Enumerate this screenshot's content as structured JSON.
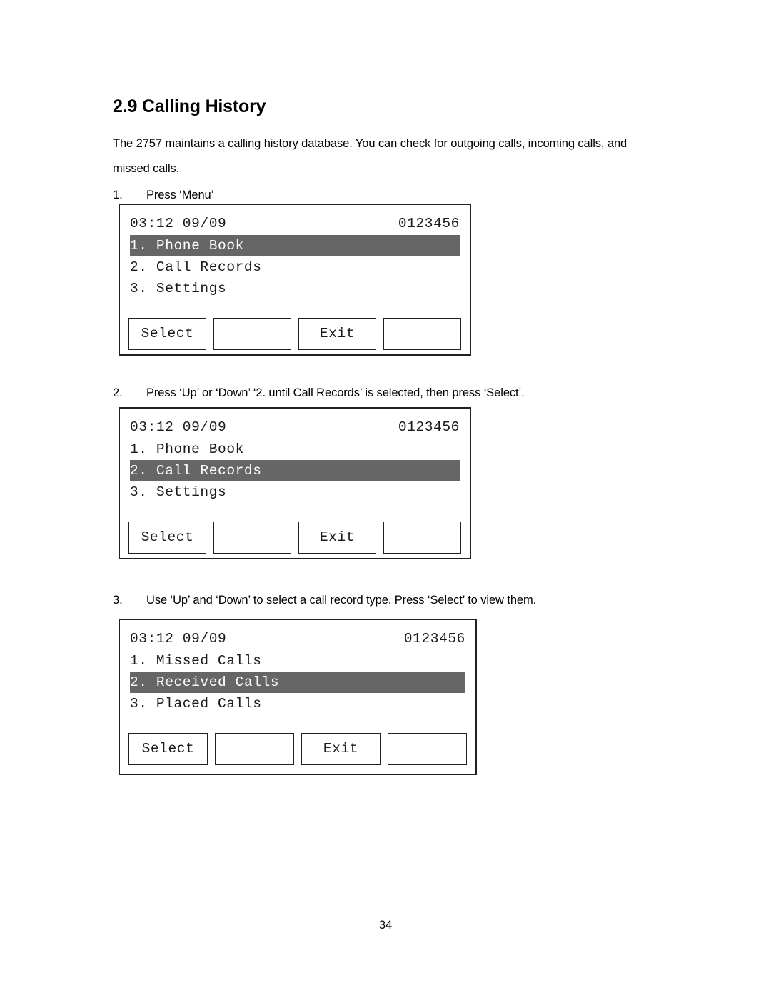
{
  "document": {
    "heading": "2.9 Calling History",
    "intro_paragraph": "The 2757 maintains a calling history database.    You can check for outgoing calls, incoming calls, and missed calls.",
    "page_number": "34",
    "steps": [
      {
        "number": "1.",
        "text": "Press ‘Menu’"
      },
      {
        "number": "2.",
        "text": "Press ‘Up’ or ‘Down’   ‘2. until Call Records’ is selected, then press ‘Select’."
      },
      {
        "number": "3.",
        "text": "Use ‘Up’ and ‘Down’ to select a call record type.   Press ‘Select’ to view them."
      }
    ]
  },
  "colors": {
    "highlight_bg": "#666666",
    "highlight_fg": "#ffffff",
    "frame_border": "#231f20",
    "lcd_text": "#1a1a1a"
  },
  "screens": [
    {
      "id": "menu-main-phonebook",
      "status": {
        "time": "03:12 09/09",
        "number": "0123456"
      },
      "menu": [
        {
          "label": "1. Phone Book",
          "selected": true
        },
        {
          "label": "2. Call Records",
          "selected": false
        },
        {
          "label": "3. Settings",
          "selected": false
        }
      ],
      "softkeys": [
        {
          "label": "Select"
        },
        {
          "label": ""
        },
        {
          "label": "Exit"
        },
        {
          "label": ""
        }
      ]
    },
    {
      "id": "menu-main-callrecords",
      "status": {
        "time": "03:12 09/09",
        "number": "0123456"
      },
      "menu": [
        {
          "label": "1. Phone Book",
          "selected": false
        },
        {
          "label": "2. Call Records",
          "selected": true
        },
        {
          "label": "3. Settings",
          "selected": false
        }
      ],
      "softkeys": [
        {
          "label": "Select"
        },
        {
          "label": ""
        },
        {
          "label": "Exit"
        },
        {
          "label": ""
        }
      ]
    },
    {
      "id": "menu-callrecord-types",
      "status": {
        "time": "03:12 09/09",
        "number": "0123456"
      },
      "menu": [
        {
          "label": "1. Missed Calls",
          "selected": false
        },
        {
          "label": "2. Received Calls",
          "selected": true
        },
        {
          "label": "3. Placed Calls",
          "selected": false
        }
      ],
      "softkeys": [
        {
          "label": "Select"
        },
        {
          "label": ""
        },
        {
          "label": "Exit"
        },
        {
          "label": ""
        }
      ]
    }
  ]
}
